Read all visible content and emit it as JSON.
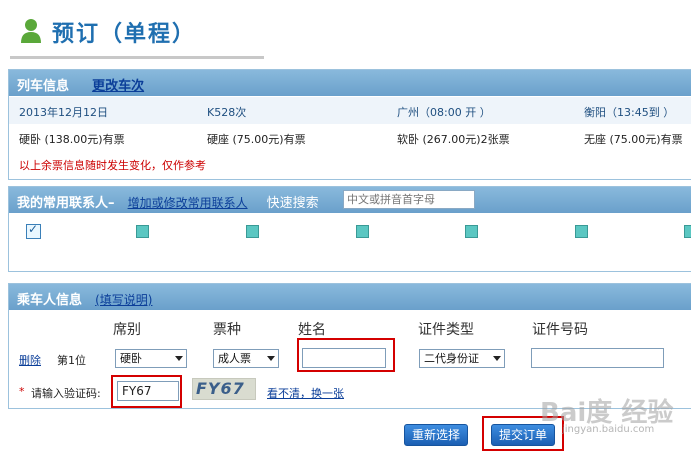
{
  "header": {
    "title": "预订（单程）"
  },
  "train_info": {
    "title": "列车信息",
    "change_link": "更改车次",
    "date": "2013年12月12日",
    "train_no": "K528次",
    "depart": "广州（08:00 开 ）",
    "arrive": "衡阳（13:45到 ）",
    "seats": [
      "硬卧 (138.00元)有票",
      "硬座 (75.00元)有票",
      "软卧 (267.00元)2张票",
      "无座 (75.00元)有票"
    ],
    "note": "以上余票信息随时发生变化，仅作参考"
  },
  "contacts": {
    "title": "我的常用联系人",
    "dash": "–",
    "manage_link": "增加或修改常用联系人",
    "quick_search_label": "快速搜索",
    "search_placeholder": "中文或拼音首字母"
  },
  "passenger": {
    "title": "乘车人信息",
    "help_link": "(填写说明)",
    "columns": [
      "席别",
      "票种",
      "姓名",
      "证件类型",
      "证件号码"
    ],
    "row": {
      "delete": "删除",
      "position": "第1位",
      "seat_class": "硬卧",
      "ticket_type": "成人票",
      "name": "",
      "id_type": "二代身份证",
      "id_number": ""
    },
    "captcha_star": "*",
    "captcha_label": "请输入验证码:",
    "captcha_value": "FY67",
    "captcha_image_text": "FY67",
    "refresh_link": "看不清，换一张"
  },
  "actions": {
    "reset": "重新选择",
    "submit": "提交订单"
  },
  "watermark": {
    "text": "Bai度 经验",
    "url": "jingyan.baidu.com"
  }
}
